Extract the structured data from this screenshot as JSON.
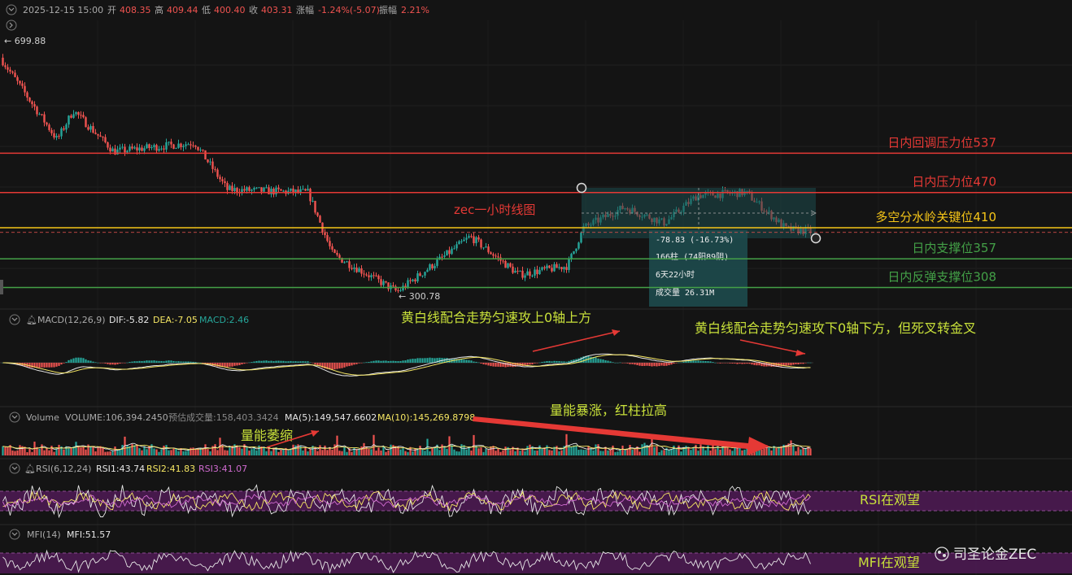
{
  "header": {
    "date": "2025-12-15 15:00",
    "open_label": "开",
    "open": "408.35",
    "high_label": "高",
    "high": "409.44",
    "low_label": "低",
    "low": "400.40",
    "close_label": "收",
    "close": "403.31",
    "change_label": "涨幅",
    "change": "-1.24%(-5.07)",
    "amp_label": "振幅",
    "amp": "2.21%"
  },
  "price": {
    "max_label": "← 699.88",
    "min_label": "← 300.78",
    "chart_title": "zec一小时线图"
  },
  "levels": [
    {
      "label": "日内回调压力位537",
      "value": 537,
      "color": "#e53935"
    },
    {
      "label": "日内压力位470",
      "value": 470,
      "color": "#e53935"
    },
    {
      "label": "多空分水岭关键位410",
      "value": 410,
      "color": "#f5c518"
    },
    {
      "label": "日内支撑位357",
      "value": 357,
      "color": "#43a047"
    },
    {
      "label": "日内反弹支撑位308",
      "value": 308,
      "color": "#43a047"
    }
  ],
  "measure": {
    "change": "-78.83 (-16.73%)",
    "bars": "166柱 (74阳89阴)",
    "duration": "6天22小时",
    "volume": "成交量 26.31M"
  },
  "macd": {
    "name": "MACD(12,26,9)",
    "dif": "DIF:-5.82",
    "dea": "DEA:-7.05",
    "macd": "MACD:2.46",
    "note1": "黄白线配合走势匀速攻上0轴上方",
    "note2": "黄白线配合走势匀速攻下0轴下方，但死叉转金叉"
  },
  "volume": {
    "name": "Volume",
    "vol": "VOLUME:106,394.2450",
    "est": "预估成交量:158,403.3424",
    "ma5": "MA(5):149,547.6602",
    "ma10": "MA(10):145,269.8798",
    "note_shrink": "量能萎缩",
    "note_surge": "量能暴涨，红柱拉高"
  },
  "rsi": {
    "name": "RSI(6,12,24)",
    "rsi1": "RSI1:43.74",
    "rsi2": "RSI2:41.83",
    "rsi3": "RSI3:41.07",
    "note": "RSI在观望"
  },
  "mfi": {
    "name": "MFI(14)",
    "value": "MFI:51.57",
    "note": "MFI在观望"
  },
  "watermark": "司圣论金ZEC",
  "colors": {
    "up": "#26a69a",
    "down": "#ef5350",
    "yellow": "#f5e663",
    "white": "#e6e6e6",
    "purple": "#5a1f5e",
    "red": "#e53935",
    "green": "#43a047",
    "gold": "#f5c518",
    "note": "#c8e03a"
  },
  "chart_data": {
    "type": "candlestick",
    "symbol": "ZEC",
    "interval": "1h",
    "price_range": [
      300.78,
      699.88
    ],
    "anchor_points": [
      {
        "t": 0,
        "price": 699.88
      },
      {
        "t": 0.07,
        "price": 560
      },
      {
        "t": 0.09,
        "price": 610
      },
      {
        "t": 0.14,
        "price": 540
      },
      {
        "t": 0.24,
        "price": 555
      },
      {
        "t": 0.28,
        "price": 475
      },
      {
        "t": 0.38,
        "price": 470
      },
      {
        "t": 0.41,
        "price": 365
      },
      {
        "t": 0.49,
        "price": 300.78
      },
      {
        "t": 0.58,
        "price": 395
      },
      {
        "t": 0.64,
        "price": 330
      },
      {
        "t": 0.7,
        "price": 345
      },
      {
        "t": 0.72,
        "price": 410
      },
      {
        "t": 0.77,
        "price": 445
      },
      {
        "t": 0.82,
        "price": 418
      },
      {
        "t": 0.86,
        "price": 465
      },
      {
        "t": 0.92,
        "price": 470
      },
      {
        "t": 0.97,
        "price": 408
      },
      {
        "t": 1.0,
        "price": 403.31
      }
    ],
    "horizontal_levels": [
      537,
      470,
      410,
      357,
      308
    ]
  }
}
